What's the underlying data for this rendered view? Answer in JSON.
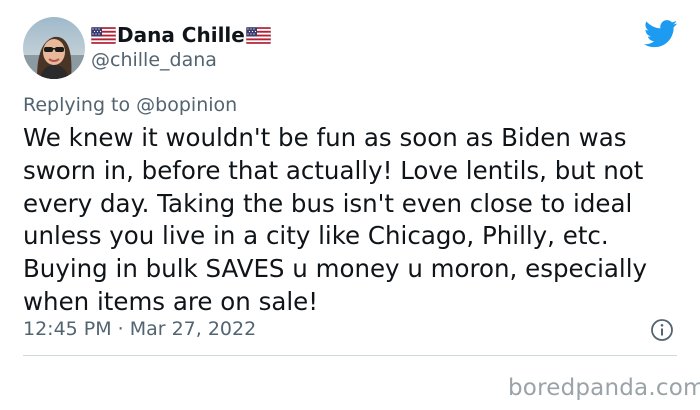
{
  "tweet": {
    "display_name": "Dana Chille",
    "handle": "@chille_dana",
    "replying_prefix": "Replying to",
    "replying_to": "@bopinion",
    "text_lines": [
      "We knew it wouldn't be fun as soon as Biden was",
      "sworn in, before that actually! Love lentils, but not",
      "every day. Taking the bus isn't even close to ideal",
      "unless you live in a city like Chicago, Philly, etc.",
      "Buying in bulk SAVES u money u moron, especially",
      "when items are on sale!"
    ],
    "time": "12:45 PM",
    "separator": "·",
    "date": "Mar 27, 2022"
  },
  "icons": {
    "avatar": "avatar",
    "flag": "us-flag-icon",
    "logo": "twitter-bird-icon",
    "info": "info-icon"
  },
  "colors": {
    "text": "#0f1419",
    "secondary": "#536471",
    "twitter_blue": "#1d9bf0",
    "divider": "#cfd9de",
    "watermark": "#9aa3a8"
  },
  "watermark": "boredpanda.com"
}
